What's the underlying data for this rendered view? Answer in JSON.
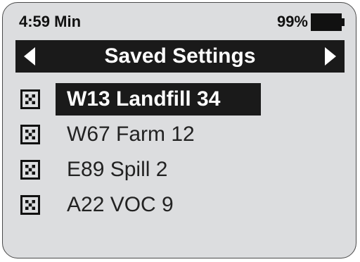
{
  "status": {
    "time": "4:59 Min",
    "battery": "99%"
  },
  "header": {
    "title": "Saved Settings"
  },
  "items": [
    {
      "label": "W13 Landfill 34",
      "selected": true
    },
    {
      "label": "W67 Farm 12",
      "selected": false
    },
    {
      "label": "E89 Spill 2",
      "selected": false
    },
    {
      "label": "A22 VOC 9",
      "selected": false
    }
  ]
}
